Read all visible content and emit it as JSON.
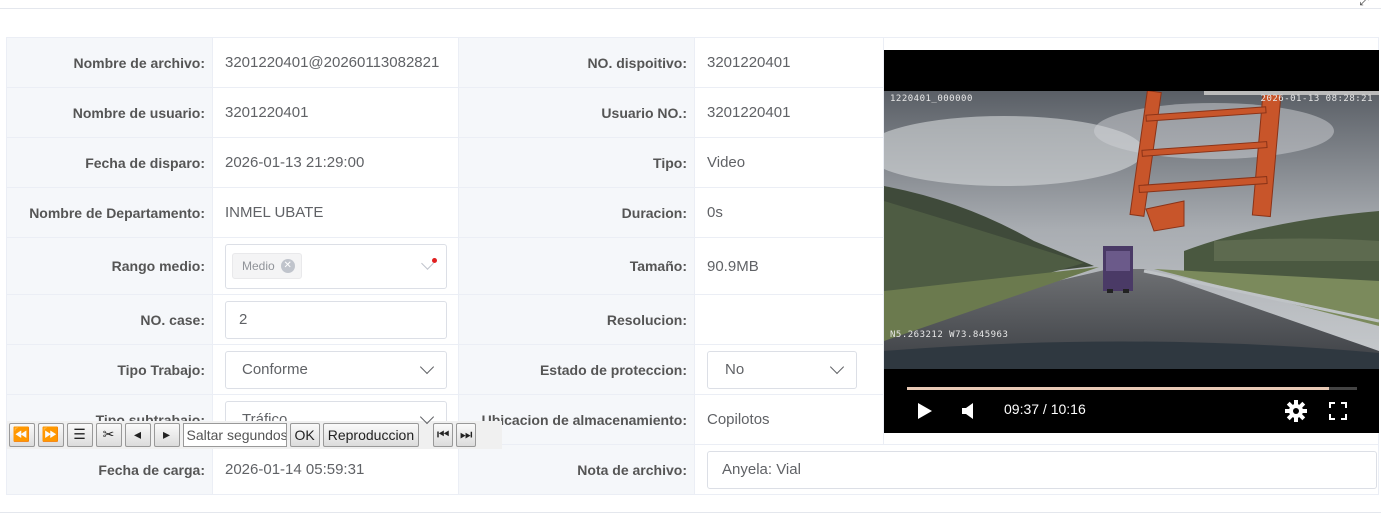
{
  "corner_icon": "expand-arrows-icon",
  "rows": {
    "file_name": {
      "label": "Nombre de archivo:",
      "value": "3201220401@20260113082821"
    },
    "device_no": {
      "label": "NO. dispoitivo:",
      "value": "3201220401"
    },
    "user_name": {
      "label": "Nombre de usuario:",
      "value": "3201220401"
    },
    "user_no": {
      "label": "Usuario NO.:",
      "value": "3201220401"
    },
    "shot_date": {
      "label": "Fecha de disparo:",
      "value": "2026-01-13 21:29:00"
    },
    "type": {
      "label": "Tipo:",
      "value": "Video"
    },
    "department": {
      "label": "Nombre de Departamento:",
      "value": "INMEL UBATE"
    },
    "duration": {
      "label": "Duracion:",
      "value": "0s"
    },
    "media_range": {
      "label": "Rango medio:",
      "tag": "Medio"
    },
    "size": {
      "label": "Tamaño:",
      "value": "90.9MB"
    },
    "case_no": {
      "label": "NO. case:",
      "value": "2"
    },
    "resolution": {
      "label": "Resolucion:",
      "value": ""
    },
    "work_type": {
      "label": "Tipo Trabajo:",
      "value": "Conforme"
    },
    "protection": {
      "label": "Estado de proteccion:",
      "value": "No"
    },
    "subwork_type": {
      "label": "Tipo subtrabajo:",
      "value": "Tráfico"
    },
    "storage": {
      "label": "Ubicacion de almacenamiento:",
      "value": "Copilotos"
    },
    "upload_date": {
      "label": "Fecha de carga:",
      "value": "2026-01-14 05:59:31"
    },
    "file_note": {
      "label": "Nota de archivo:",
      "value": "Anyela: Vial"
    }
  },
  "video": {
    "osd_left": "1220401_000000",
    "osd_right": "2026-01-13 08:28:21",
    "gps": "N5.263212 W73.845963",
    "current_time": "09:37",
    "total_time": "10:16",
    "time_text": "09:37 / 10:16",
    "progress": 0.937,
    "colors": {
      "progress": "#e8c9b5",
      "truck": "#c8552a"
    }
  },
  "toolbar": {
    "seek_placeholder": "Saltar segundos",
    "ok_label": "OK",
    "playback_label": "Reproduccion"
  }
}
